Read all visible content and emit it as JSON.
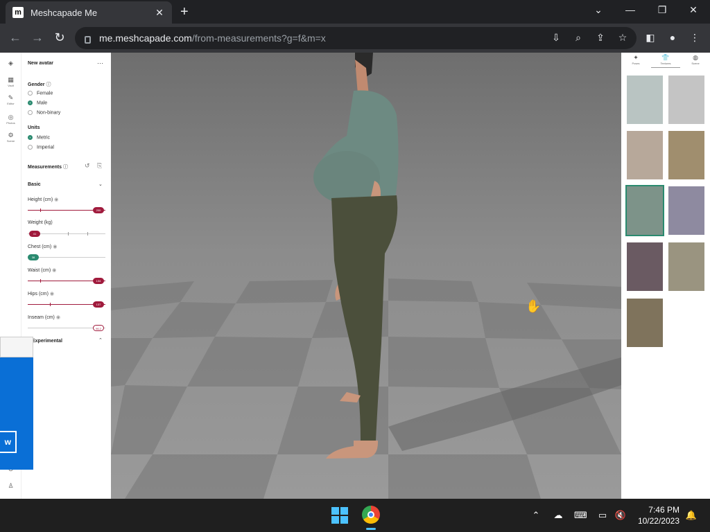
{
  "browser": {
    "tab_title": "Meshcapade Me",
    "tab_favicon": "m",
    "tab_close": "✕",
    "newtab": "+",
    "url_host": "me.meshcapade.com",
    "url_path": "/from-measurements?g=f&m=x",
    "window_controls": [
      "⌄",
      "—",
      "❐",
      "✕"
    ]
  },
  "rail": {
    "items": [
      {
        "icon": "◈",
        "label": ""
      },
      {
        "icon": "▦",
        "label": "Vault"
      },
      {
        "icon": "✎",
        "label": "Editor"
      },
      {
        "icon": "◎",
        "label": "Photos"
      },
      {
        "icon": "⚙",
        "label": "Scene"
      }
    ]
  },
  "panel": {
    "title": "New avatar",
    "menu": "···",
    "gender_label": "Gender",
    "gender_options": [
      "Female",
      "Male",
      "Non-binary"
    ],
    "gender_selected": "Male",
    "units_label": "Units",
    "units_options": [
      "Metric",
      "Imperial"
    ],
    "units_selected": "Metric",
    "measurements_label": "Measurements",
    "basic_label": "Basic",
    "measures": [
      {
        "label": "Height (cm)",
        "value": "200",
        "fraction": 1.0
      },
      {
        "label": "Weight (kg)",
        "value": "41",
        "fraction": 0.0
      },
      {
        "label": "Chest (cm)",
        "value": "38",
        "fraction": 0.0
      },
      {
        "label": "Waist (cm)",
        "value": "134",
        "fraction": 1.0
      },
      {
        "label": "Hips (cm)",
        "value": "137",
        "fraction": 1.0
      },
      {
        "label": "Inseam (cm)",
        "value": "96.2",
        "fraction": 1.0
      }
    ],
    "experimental_label": "Experimental"
  },
  "popup": {
    "button_label": "w"
  },
  "right_panel": {
    "tabs": [
      {
        "icon": "✦",
        "label": "Poses"
      },
      {
        "icon": "👕",
        "label": "Textures"
      },
      {
        "icon": "◍",
        "label": "Scene"
      }
    ],
    "thumbnail_count": 9,
    "selected_index": 4
  },
  "taskbar": {
    "time": "7:46 PM",
    "date": "10/22/2023"
  }
}
